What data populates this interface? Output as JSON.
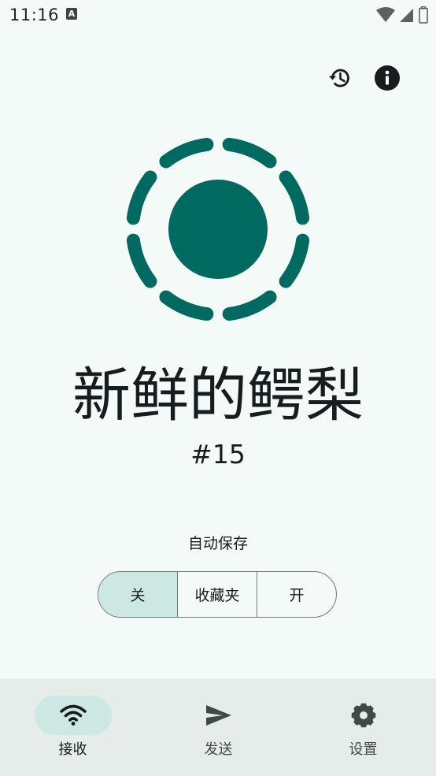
{
  "status_bar": {
    "time": "11:16",
    "notification_icon": "A"
  },
  "header_actions": {
    "history_icon": "history-icon",
    "info_icon": "info-icon"
  },
  "device": {
    "name": "新鲜的鳄梨",
    "number": "#15"
  },
  "autosave": {
    "label": "自动保存",
    "options": [
      "关",
      "收藏夹",
      "开"
    ],
    "selected": "关"
  },
  "bottom_nav": {
    "items": [
      {
        "label": "接收",
        "icon": "wifi-icon",
        "active": true
      },
      {
        "label": "发送",
        "icon": "send-icon",
        "active": false
      },
      {
        "label": "设置",
        "icon": "gear-icon",
        "active": false
      }
    ]
  },
  "colors": {
    "background": "#f4faf8",
    "accent": "#006a60",
    "selected_container": "#cde8e2",
    "nav_background": "#e6ecea"
  }
}
